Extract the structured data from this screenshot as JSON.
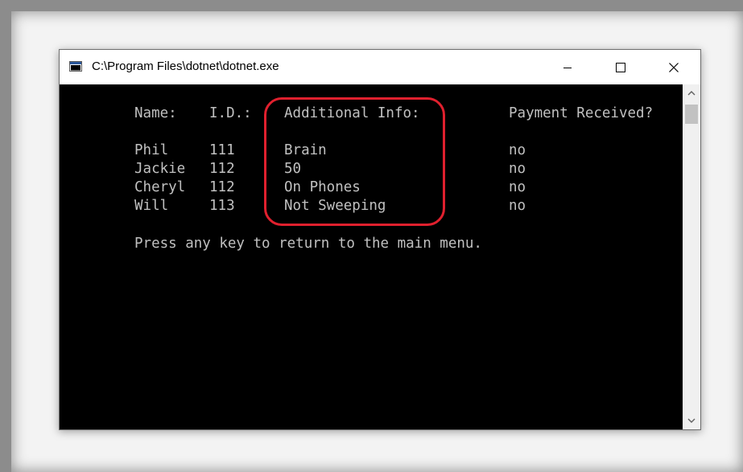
{
  "window": {
    "title": "C:\\Program Files\\dotnet\\dotnet.exe",
    "icon": "console-app-icon",
    "controls": {
      "minimize": "minimize-icon",
      "maximize": "maximize-icon",
      "close": "close-icon"
    }
  },
  "terminal": {
    "headers": {
      "name": "Name:",
      "id": "I.D.:",
      "info": "Additional Info:",
      "payment": "Payment Received?"
    },
    "rows": [
      {
        "name": "Phil",
        "id": "111",
        "info": "Brain",
        "payment": "no"
      },
      {
        "name": "Jackie",
        "id": "112",
        "info": "50",
        "payment": "no"
      },
      {
        "name": "Cheryl",
        "id": "112",
        "info": "On Phones",
        "payment": "no"
      },
      {
        "name": "Will",
        "id": "113",
        "info": "Not Sweeping",
        "payment": "no"
      }
    ],
    "prompt": "Press any key to return to the main menu."
  },
  "colors": {
    "console_background": "#000000",
    "console_text": "#c0c0c0",
    "highlight": "#e0202e"
  }
}
